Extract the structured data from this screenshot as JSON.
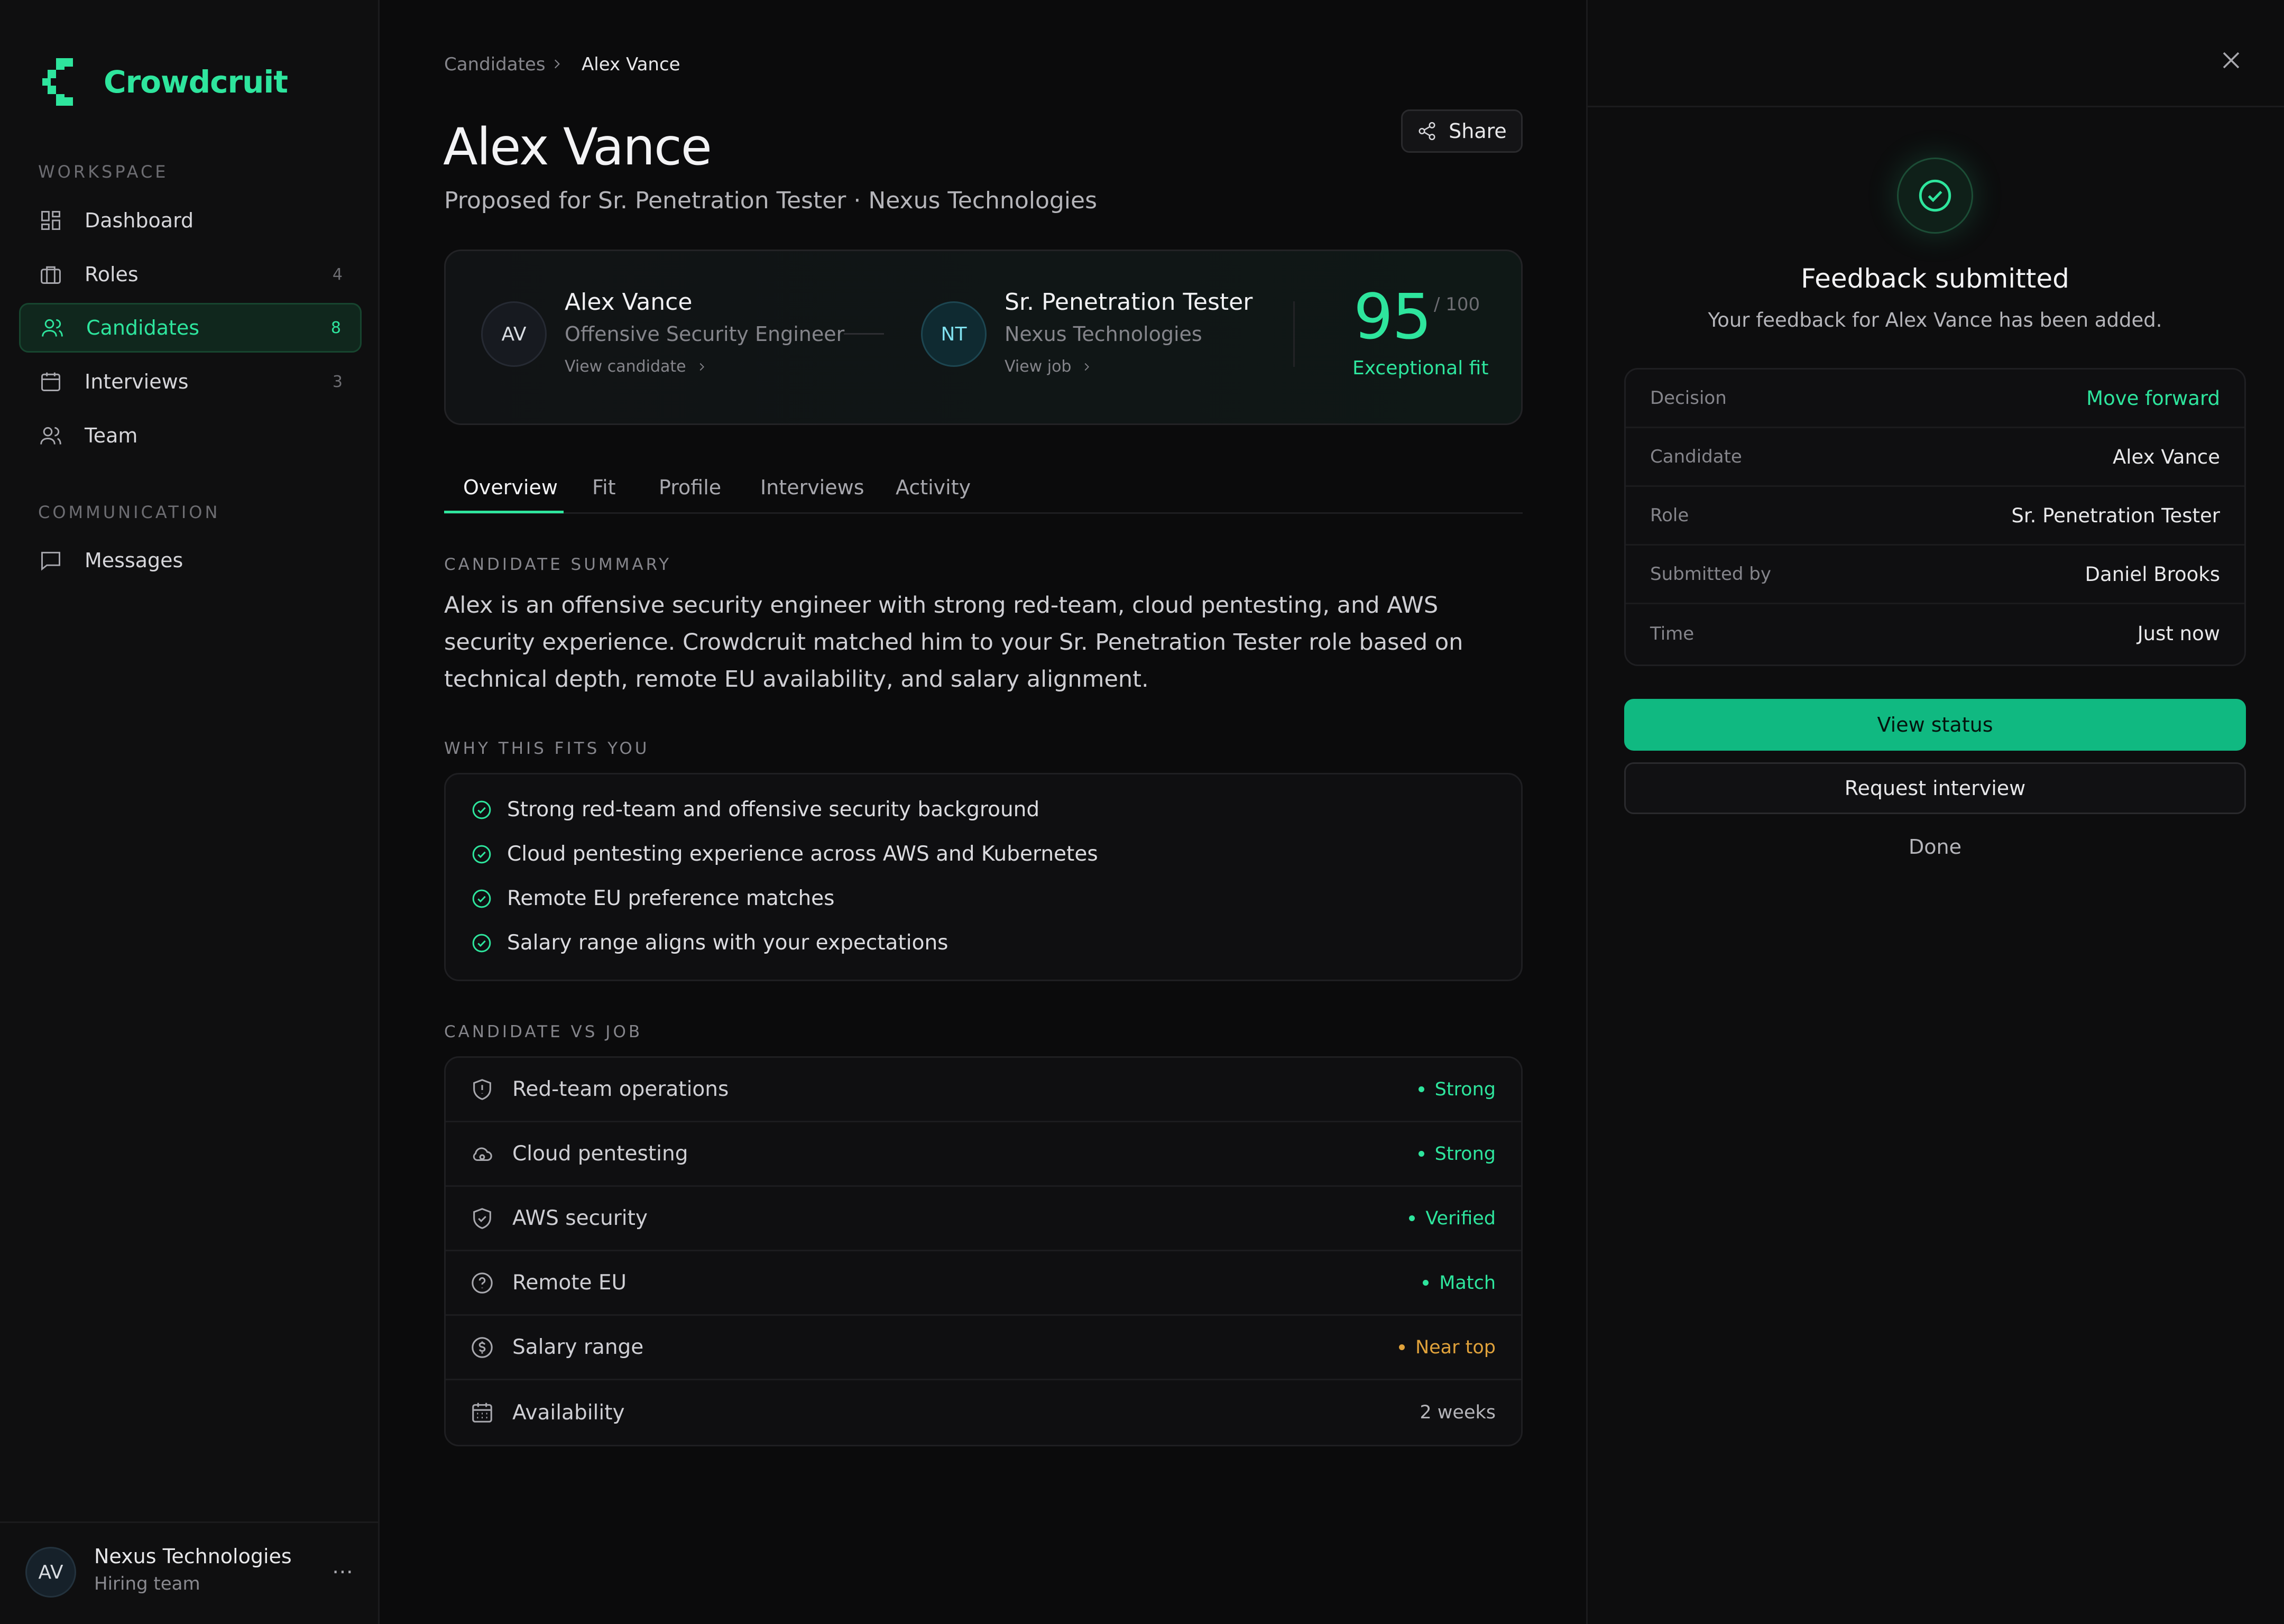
{
  "brand": {
    "name": "Crowdcruit",
    "accent": "#2ee59d"
  },
  "sidebar": {
    "workspace_label": "WORKSPACE",
    "communication_label": "COMMUNICATION",
    "items": [
      {
        "label": "Dashboard",
        "count": "",
        "icon": "dashboard-icon"
      },
      {
        "label": "Roles",
        "count": "4",
        "icon": "briefcase-icon"
      },
      {
        "label": "Candidates",
        "count": "8",
        "icon": "users-icon",
        "active": true
      },
      {
        "label": "Interviews",
        "count": "3",
        "icon": "calendar-icon"
      },
      {
        "label": "Team",
        "count": "",
        "icon": "team-icon"
      }
    ],
    "comm_items": [
      {
        "label": "Messages",
        "icon": "message-icon"
      }
    ],
    "account": {
      "initials": "AV",
      "name": "Nexus Technologies",
      "sub": "Hiring team",
      "more": "⋯"
    }
  },
  "breadcrumb": {
    "parent": "Candidates",
    "current": "Alex Vance"
  },
  "header": {
    "title": "Alex Vance",
    "subtitle": "Proposed for Sr. Penetration Tester · Nexus Technologies",
    "share_label": "Share"
  },
  "match": {
    "candidate": {
      "initials": "AV",
      "name": "Alex Vance",
      "role": "Offensive Security Engineer",
      "link": "View candidate"
    },
    "job": {
      "initials": "NT",
      "title": "Sr. Penetration Tester",
      "company": "Nexus Technologies",
      "link": "View job"
    },
    "score": "95",
    "score_of": "/ 100",
    "fit_label": "Exceptional fit"
  },
  "tabs": [
    "Overview",
    "Fit",
    "Profile",
    "Interviews",
    "Activity"
  ],
  "summary": {
    "label": "CANDIDATE SUMMARY",
    "text": "Alex is an offensive security engineer with strong red-team, cloud pentesting, and AWS security experience. Crowdcruit matched him to your Sr. Penetration Tester role based on technical depth, remote EU availability, and salary alignment."
  },
  "why_fits": {
    "label": "WHY THIS FITS YOU",
    "items": [
      "Strong red-team and offensive security background",
      "Cloud pentesting experience across AWS and Kubernetes",
      "Remote EU preference matches",
      "Salary range aligns with your expectations"
    ]
  },
  "comparison": {
    "label": "CANDIDATE VS JOB",
    "rows": [
      {
        "label": "Red-team operations",
        "status": "Strong",
        "color": "#2ee59d",
        "icon": "shield-alert-icon"
      },
      {
        "label": "Cloud pentesting",
        "status": "Strong",
        "color": "#2ee59d",
        "icon": "cloud-icon"
      },
      {
        "label": "AWS security",
        "status": "Verified",
        "color": "#2ee59d",
        "icon": "shield-check-icon"
      },
      {
        "label": "Remote EU",
        "status": "Match",
        "color": "#2ee59d",
        "icon": "question-circle-icon"
      },
      {
        "label": "Salary range",
        "status": "Near top",
        "color": "#e0a23b",
        "icon": "dollar-circle-icon"
      },
      {
        "label": "Availability",
        "status": "2 weeks",
        "color": "",
        "icon": "calendar-icon"
      }
    ]
  },
  "feedback": {
    "title": "Feedback submitted",
    "subtitle": "Your feedback for Alex Vance has been added.",
    "details": [
      {
        "key": "Decision",
        "value": "Move forward",
        "accent": true
      },
      {
        "key": "Candidate",
        "value": "Alex Vance"
      },
      {
        "key": "Role",
        "value": "Sr. Penetration Tester"
      },
      {
        "key": "Submitted by",
        "value": "Daniel Brooks"
      },
      {
        "key": "Time",
        "value": "Just now"
      }
    ],
    "primary_button": "View status",
    "secondary_button": "Request interview",
    "done_button": "Done"
  }
}
